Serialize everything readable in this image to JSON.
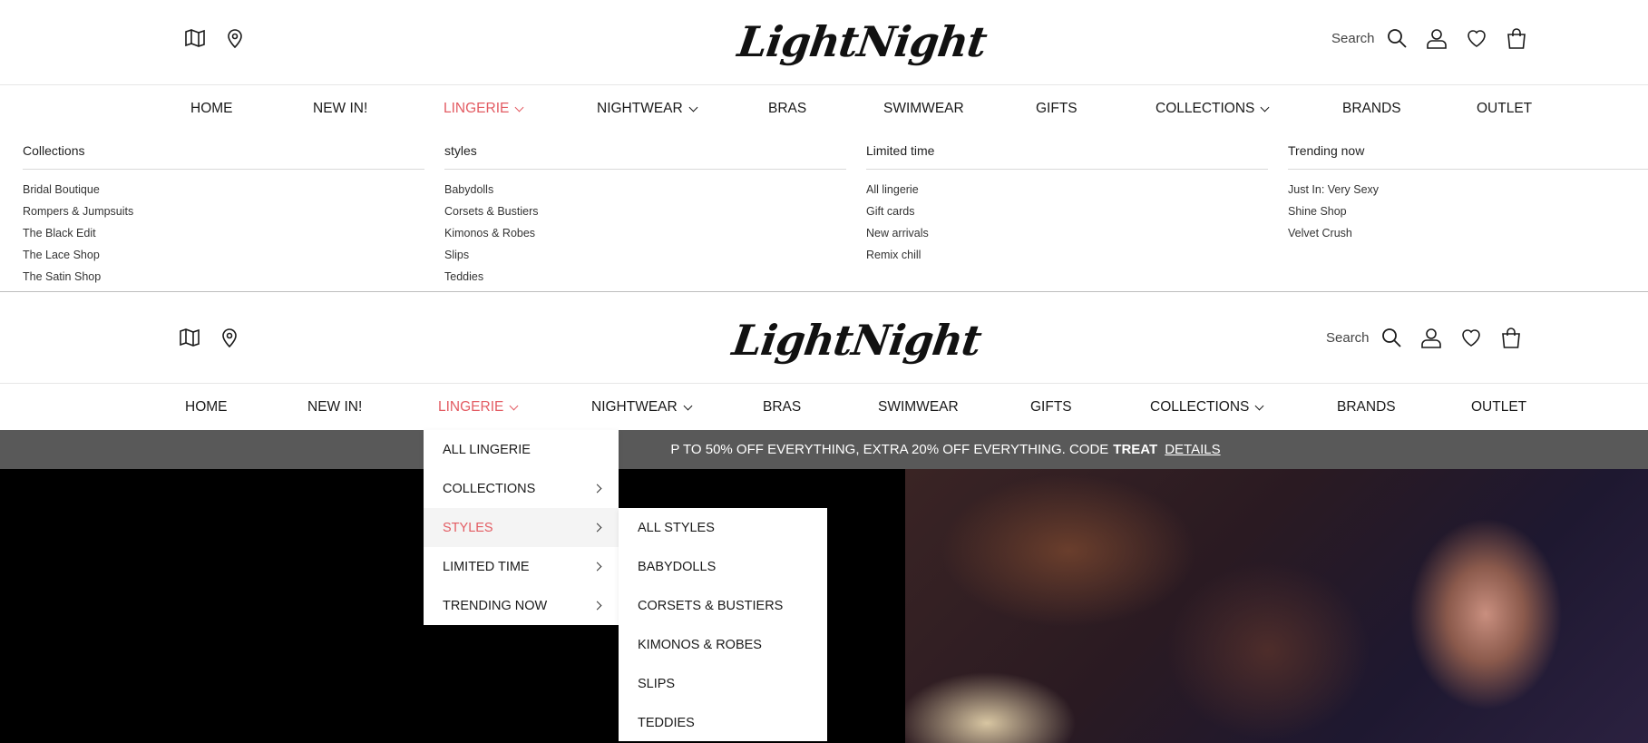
{
  "brand": {
    "logo_text": "LightNight"
  },
  "header": {
    "search_label": "Search",
    "left_icons": [
      "map-icon",
      "location-pin-icon"
    ],
    "right_icons": [
      "search-icon",
      "account-icon",
      "wishlist-heart-icon",
      "shopping-bag-icon"
    ]
  },
  "nav": {
    "items": [
      {
        "label": "HOME"
      },
      {
        "label": "NEW IN!"
      },
      {
        "label": "LINGERIE",
        "active": true
      },
      {
        "label": "NIGHTWEAR"
      },
      {
        "label": "BRAS"
      },
      {
        "label": "SWIMWEAR"
      },
      {
        "label": "GIFTS"
      },
      {
        "label": "COLLECTIONS"
      },
      {
        "label": "BRANDS"
      },
      {
        "label": "OUTLET"
      }
    ],
    "active_color": "#e35c63"
  },
  "mega_menu": {
    "columns": [
      {
        "heading": "Collections",
        "links": [
          "Bridal Boutique",
          "Rompers & Jumpsuits",
          "The Black Edit",
          "The Lace Shop",
          "The Satin Shop"
        ]
      },
      {
        "heading": "styles",
        "links": [
          "Babydolls",
          "Corsets & Bustiers",
          "Kimonos & Robes",
          "Slips",
          "Teddies"
        ]
      },
      {
        "heading": "Limited time",
        "links": [
          "All lingerie",
          "Gift cards",
          "New arrivals",
          "Remix chill"
        ]
      },
      {
        "heading": "Trending now",
        "links": [
          "Just In: Very Sexy",
          "Shine Shop",
          "Velvet Crush"
        ]
      }
    ]
  },
  "promo": {
    "text": "P TO 50% OFF EVERYTHING, EXTRA 20% OFF EVERYTHING. CODE",
    "code": "TREAT",
    "details": "DETAILS"
  },
  "dropdown": {
    "items": [
      {
        "label": "ALL LINGERIE"
      },
      {
        "label": "COLLECTIONS"
      },
      {
        "label": "STYLES"
      },
      {
        "label": "LIMITED TIME"
      },
      {
        "label": "TRENDING NOW"
      }
    ],
    "submenu": [
      "ALL STYLES",
      "BABYDOLLS",
      "CORSETS & BUSTIERS",
      "KIMONOS & ROBES",
      "SLIPS",
      "TEDDIES"
    ]
  }
}
